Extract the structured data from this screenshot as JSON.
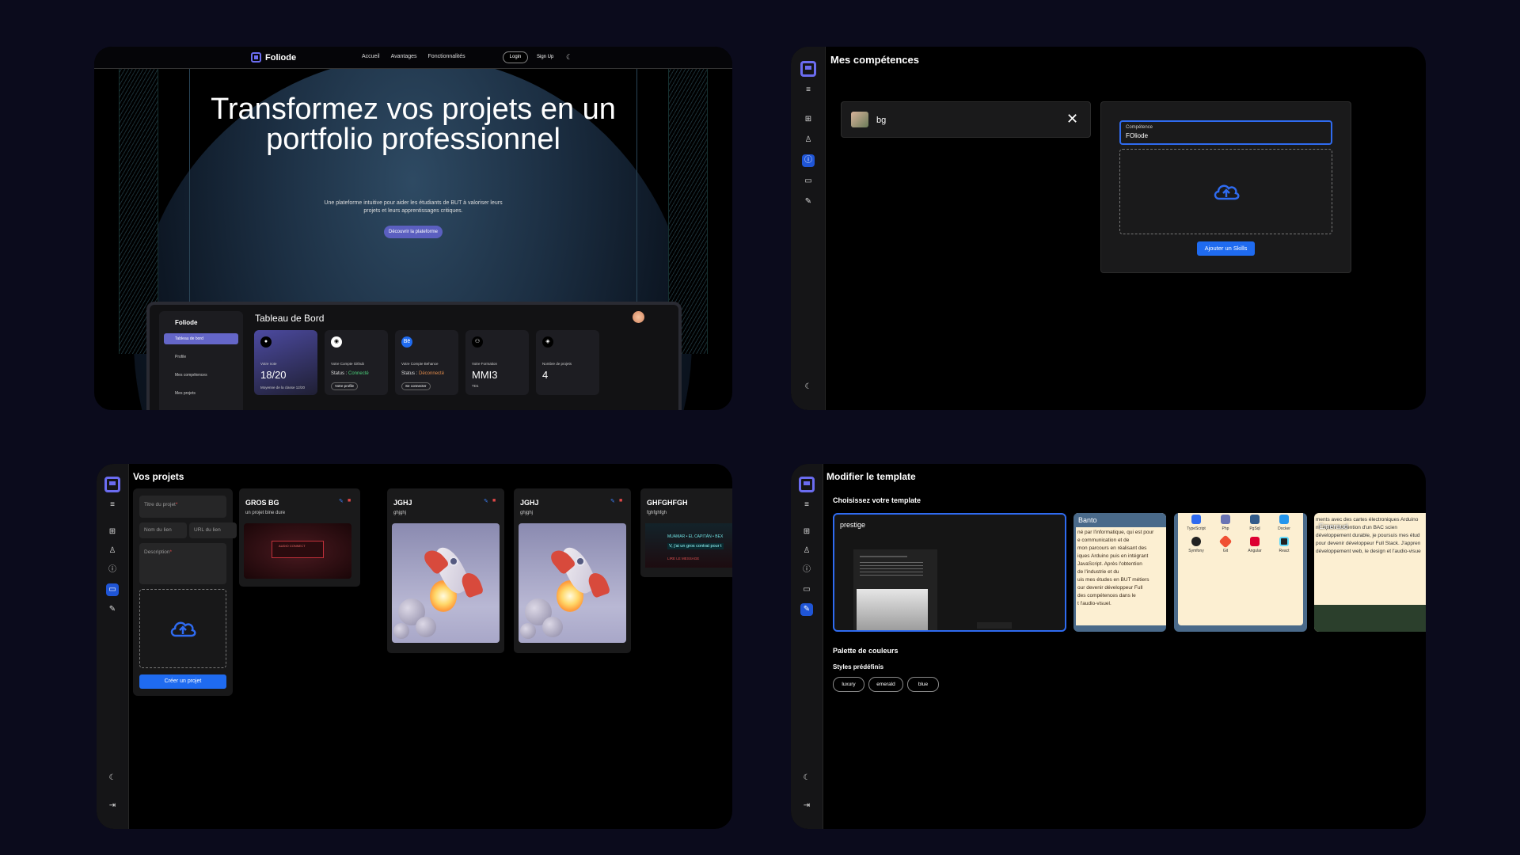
{
  "landing": {
    "brand": "Foliode",
    "nav": [
      "Accueil",
      "Avantages",
      "Fonctionnalités"
    ],
    "login": "Login",
    "signup": "Sign Up",
    "hero_title": "Transformez vos projets en un portfolio professionnel",
    "hero_subtitle": "Une plateforme intuitive pour aider les étudiants de BUT à valoriser leurs projets et leurs apprentissages critiques.",
    "cta": "Découvrir la plateforme",
    "dashboard": {
      "brand": "Foliode",
      "title": "Tableau de Bord",
      "menu": [
        "Tableau de bord",
        "Profile",
        "Mes compétences",
        "Mes projets"
      ],
      "cards": [
        {
          "label": "Votre note",
          "value": "18/20",
          "extra": "Moyenne de la classe 12/20"
        },
        {
          "label": "Votre Compte Github",
          "status_label": "Status : ",
          "status": "Connecté",
          "button": "Votre profile"
        },
        {
          "label": "Votre Compte Behance",
          "status_label": "Status : ",
          "status": "Déconnecté",
          "button": "Se connecter"
        },
        {
          "label": "Votre Formation",
          "value": "MMI3",
          "extra": "TD1"
        },
        {
          "label": "Nombre de projets",
          "value": "4"
        }
      ]
    }
  },
  "skills": {
    "title": "Mes compétences",
    "item_name": "bg",
    "field_label": "Compétence",
    "field_value": "FOliode",
    "submit": "Ajouter un Skills"
  },
  "projects": {
    "title": "Vos projets",
    "form": {
      "title_ph": "Titre du projet",
      "link_name_ph": "Nom du lien",
      "link_url_ph": "URL du lien",
      "description_ph": "Description",
      "required_mark": "*",
      "submit": "Créer un projet"
    },
    "cards": [
      {
        "title": "GROS BG",
        "desc": "un projet bine dure"
      },
      {
        "title": "JGHJ",
        "desc": "ghjghj"
      },
      {
        "title": "JGHJ",
        "desc": "ghjghj"
      },
      {
        "title": "GHFGHFGH",
        "desc": "fghfghfgh"
      }
    ],
    "preview_texts": {
      "banner": "AUDIO CONNECT",
      "ticker": "MUAMAR • EL CAPITÁN • BEX",
      "ticker2": "V, j'ai un gros contrat pour t",
      "tag": "LIRE LE MESSAGE"
    }
  },
  "template": {
    "title": "Modifier le template",
    "choose": "Choisissez votre template",
    "cards": [
      {
        "name": "prestige"
      },
      {
        "name": "Banto",
        "lines": [
          "né par l'informatique, qui est pour",
          "e communication et de",
          "mon parcours en réalisant des",
          "iques Arduino puis en intégrant",
          "JavaScript. Après l'obtention",
          "de l'industrie et du",
          "uis mes études en BUT métiers",
          "our devenir développeur Full",
          "des compétences dans le",
          "t l'audio-visuel."
        ]
      },
      {
        "techs": [
          "TypeScript",
          "Php",
          "PgSql",
          "Docker",
          "Symfony",
          "Git",
          "Angular",
          "React"
        ]
      },
      {
        "name": "Emeraud",
        "lines": [
          "ments avec des cartes électroniques Arduino",
          "nt. Après l'obtention d'un BAC scien",
          "développement durable, je poursuis mes étud",
          "pour devenir développeur Full Stack. J'appren",
          "développement web, le design et l'audio-visue"
        ]
      }
    ],
    "palette": "Palette de couleurs",
    "styles": "Styles prédéfinis",
    "chips": [
      "luxury",
      "emerald",
      "blue"
    ]
  },
  "colors": {
    "accent": "#1f6bf0",
    "brand": "#6b6cf0",
    "danger": "#e04848",
    "success": "#4ad07a"
  }
}
